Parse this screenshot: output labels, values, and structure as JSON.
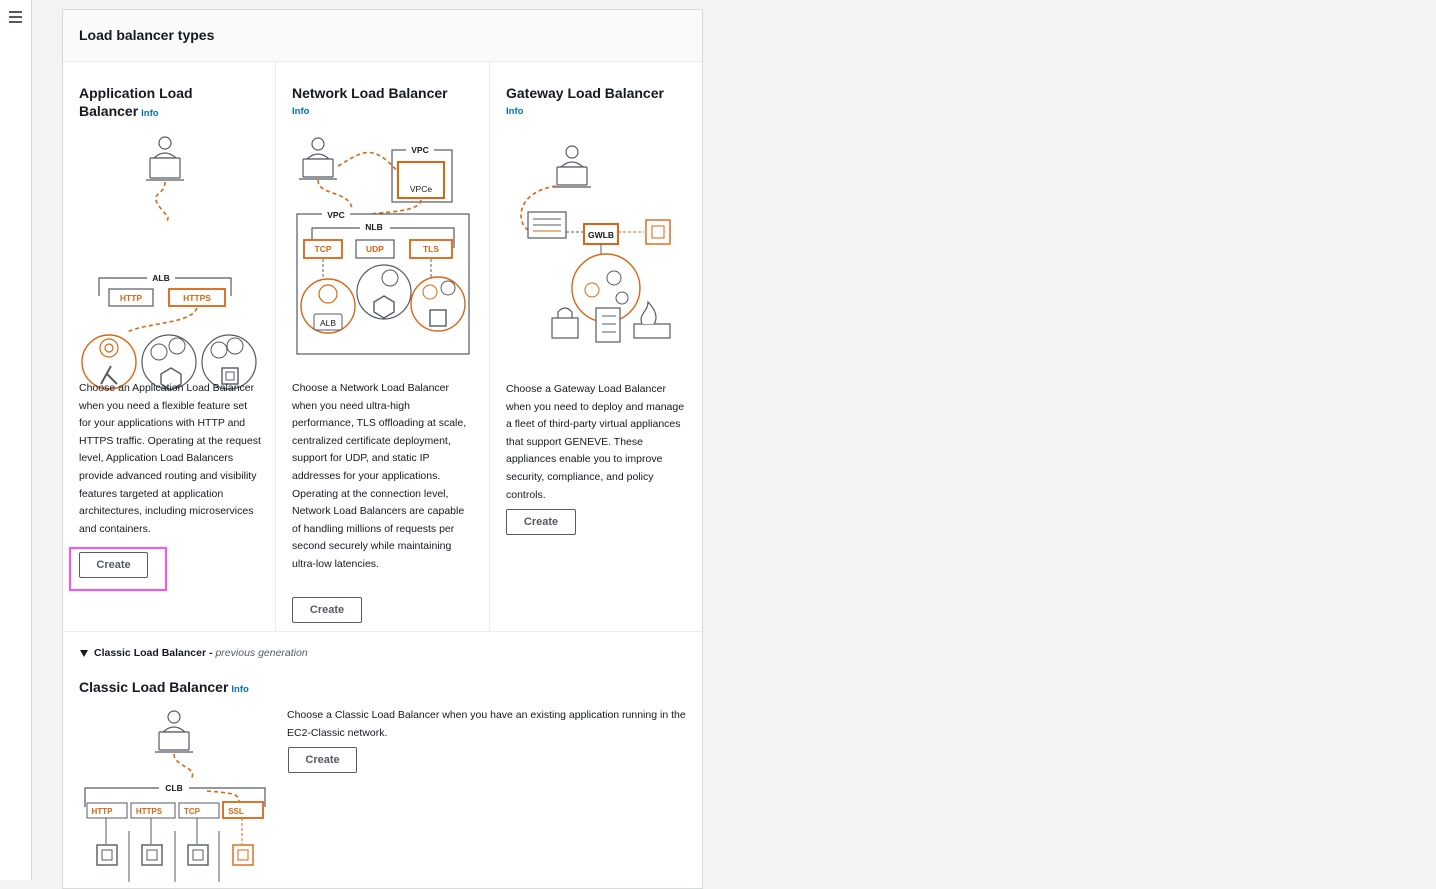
{
  "nav": {
    "menu_icon": "hamburger-menu-icon"
  },
  "panel": {
    "title": "Load balancer types"
  },
  "cards": [
    {
      "title": "Application Load Balancer",
      "info": "Info",
      "description": "Choose an Application Load Balancer when you need a flexible feature set for your applications with HTTP and HTTPS traffic. Operating at the request level, Application Load Balancers provide advanced routing and visibility features targeted at application architectures, including microservices and containers.",
      "button": "Create",
      "diagram": {
        "gateway": "ALB",
        "listeners": [
          "HTTP",
          "HTTPS"
        ]
      }
    },
    {
      "title": "Network Load Balancer",
      "info": "Info",
      "description": "Choose a Network Load Balancer when you need ultra-high performance, TLS offloading at scale, centralized certificate deployment, support for UDP, and static IP addresses for your applications. Operating at the connection level, Network Load Balancers are capable of handling millions of requests per second securely while maintaining ultra-low latencies.",
      "button": "Create",
      "diagram": {
        "outer_vpc": "VPC",
        "endpoint": "VPCe",
        "inner_vpc": "VPC",
        "gateway": "NLB",
        "listeners": [
          "TCP",
          "UDP",
          "TLS"
        ],
        "target": "ALB"
      }
    },
    {
      "title": "Gateway Load Balancer",
      "info": "Info",
      "description": "Choose a Gateway Load Balancer when you need to deploy and manage a fleet of third-party virtual appliances that support GENEVE. These appliances enable you to improve security, compliance, and policy controls.",
      "button": "Create",
      "diagram": {
        "gateway": "GWLB"
      }
    }
  ],
  "classic": {
    "toggle_label": "Classic Load Balancer -",
    "toggle_suffix": "previous generation",
    "title": "Classic Load Balancer",
    "info": "Info",
    "description": "Choose a Classic Load Balancer when you have an existing application running in the EC2-Classic network.",
    "button": "Create",
    "diagram": {
      "gateway": "CLB",
      "listeners": [
        "HTTP",
        "HTTPS",
        "TCP",
        "SSL"
      ]
    }
  },
  "colors": {
    "accent_orange": "#d86613",
    "link_blue": "#0073bb",
    "highlight": "#ff4dff",
    "icon_gray": "#545b64"
  }
}
